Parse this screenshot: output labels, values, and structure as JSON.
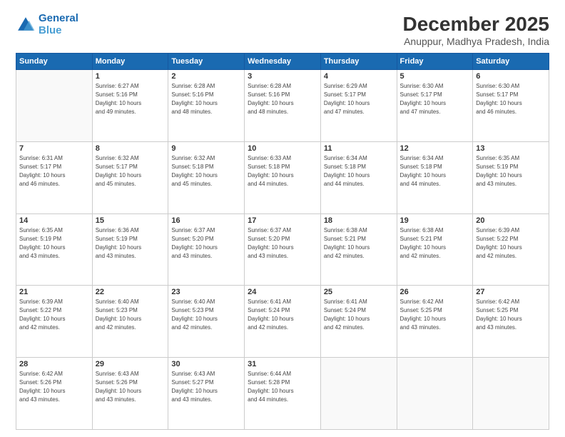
{
  "logo": {
    "line1": "General",
    "line2": "Blue"
  },
  "title": "December 2025",
  "subtitle": "Anuppur, Madhya Pradesh, India",
  "days_header": [
    "Sunday",
    "Monday",
    "Tuesday",
    "Wednesday",
    "Thursday",
    "Friday",
    "Saturday"
  ],
  "weeks": [
    [
      {
        "day": "",
        "info": ""
      },
      {
        "day": "1",
        "info": "Sunrise: 6:27 AM\nSunset: 5:16 PM\nDaylight: 10 hours\nand 49 minutes."
      },
      {
        "day": "2",
        "info": "Sunrise: 6:28 AM\nSunset: 5:16 PM\nDaylight: 10 hours\nand 48 minutes."
      },
      {
        "day": "3",
        "info": "Sunrise: 6:28 AM\nSunset: 5:16 PM\nDaylight: 10 hours\nand 48 minutes."
      },
      {
        "day": "4",
        "info": "Sunrise: 6:29 AM\nSunset: 5:17 PM\nDaylight: 10 hours\nand 47 minutes."
      },
      {
        "day": "5",
        "info": "Sunrise: 6:30 AM\nSunset: 5:17 PM\nDaylight: 10 hours\nand 47 minutes."
      },
      {
        "day": "6",
        "info": "Sunrise: 6:30 AM\nSunset: 5:17 PM\nDaylight: 10 hours\nand 46 minutes."
      }
    ],
    [
      {
        "day": "7",
        "info": "Sunrise: 6:31 AM\nSunset: 5:17 PM\nDaylight: 10 hours\nand 46 minutes."
      },
      {
        "day": "8",
        "info": "Sunrise: 6:32 AM\nSunset: 5:17 PM\nDaylight: 10 hours\nand 45 minutes."
      },
      {
        "day": "9",
        "info": "Sunrise: 6:32 AM\nSunset: 5:18 PM\nDaylight: 10 hours\nand 45 minutes."
      },
      {
        "day": "10",
        "info": "Sunrise: 6:33 AM\nSunset: 5:18 PM\nDaylight: 10 hours\nand 44 minutes."
      },
      {
        "day": "11",
        "info": "Sunrise: 6:34 AM\nSunset: 5:18 PM\nDaylight: 10 hours\nand 44 minutes."
      },
      {
        "day": "12",
        "info": "Sunrise: 6:34 AM\nSunset: 5:18 PM\nDaylight: 10 hours\nand 44 minutes."
      },
      {
        "day": "13",
        "info": "Sunrise: 6:35 AM\nSunset: 5:19 PM\nDaylight: 10 hours\nand 43 minutes."
      }
    ],
    [
      {
        "day": "14",
        "info": "Sunrise: 6:35 AM\nSunset: 5:19 PM\nDaylight: 10 hours\nand 43 minutes."
      },
      {
        "day": "15",
        "info": "Sunrise: 6:36 AM\nSunset: 5:19 PM\nDaylight: 10 hours\nand 43 minutes."
      },
      {
        "day": "16",
        "info": "Sunrise: 6:37 AM\nSunset: 5:20 PM\nDaylight: 10 hours\nand 43 minutes."
      },
      {
        "day": "17",
        "info": "Sunrise: 6:37 AM\nSunset: 5:20 PM\nDaylight: 10 hours\nand 43 minutes."
      },
      {
        "day": "18",
        "info": "Sunrise: 6:38 AM\nSunset: 5:21 PM\nDaylight: 10 hours\nand 42 minutes."
      },
      {
        "day": "19",
        "info": "Sunrise: 6:38 AM\nSunset: 5:21 PM\nDaylight: 10 hours\nand 42 minutes."
      },
      {
        "day": "20",
        "info": "Sunrise: 6:39 AM\nSunset: 5:22 PM\nDaylight: 10 hours\nand 42 minutes."
      }
    ],
    [
      {
        "day": "21",
        "info": "Sunrise: 6:39 AM\nSunset: 5:22 PM\nDaylight: 10 hours\nand 42 minutes."
      },
      {
        "day": "22",
        "info": "Sunrise: 6:40 AM\nSunset: 5:23 PM\nDaylight: 10 hours\nand 42 minutes."
      },
      {
        "day": "23",
        "info": "Sunrise: 6:40 AM\nSunset: 5:23 PM\nDaylight: 10 hours\nand 42 minutes."
      },
      {
        "day": "24",
        "info": "Sunrise: 6:41 AM\nSunset: 5:24 PM\nDaylight: 10 hours\nand 42 minutes."
      },
      {
        "day": "25",
        "info": "Sunrise: 6:41 AM\nSunset: 5:24 PM\nDaylight: 10 hours\nand 42 minutes."
      },
      {
        "day": "26",
        "info": "Sunrise: 6:42 AM\nSunset: 5:25 PM\nDaylight: 10 hours\nand 43 minutes."
      },
      {
        "day": "27",
        "info": "Sunrise: 6:42 AM\nSunset: 5:25 PM\nDaylight: 10 hours\nand 43 minutes."
      }
    ],
    [
      {
        "day": "28",
        "info": "Sunrise: 6:42 AM\nSunset: 5:26 PM\nDaylight: 10 hours\nand 43 minutes."
      },
      {
        "day": "29",
        "info": "Sunrise: 6:43 AM\nSunset: 5:26 PM\nDaylight: 10 hours\nand 43 minutes."
      },
      {
        "day": "30",
        "info": "Sunrise: 6:43 AM\nSunset: 5:27 PM\nDaylight: 10 hours\nand 43 minutes."
      },
      {
        "day": "31",
        "info": "Sunrise: 6:44 AM\nSunset: 5:28 PM\nDaylight: 10 hours\nand 44 minutes."
      },
      {
        "day": "",
        "info": ""
      },
      {
        "day": "",
        "info": ""
      },
      {
        "day": "",
        "info": ""
      }
    ]
  ]
}
